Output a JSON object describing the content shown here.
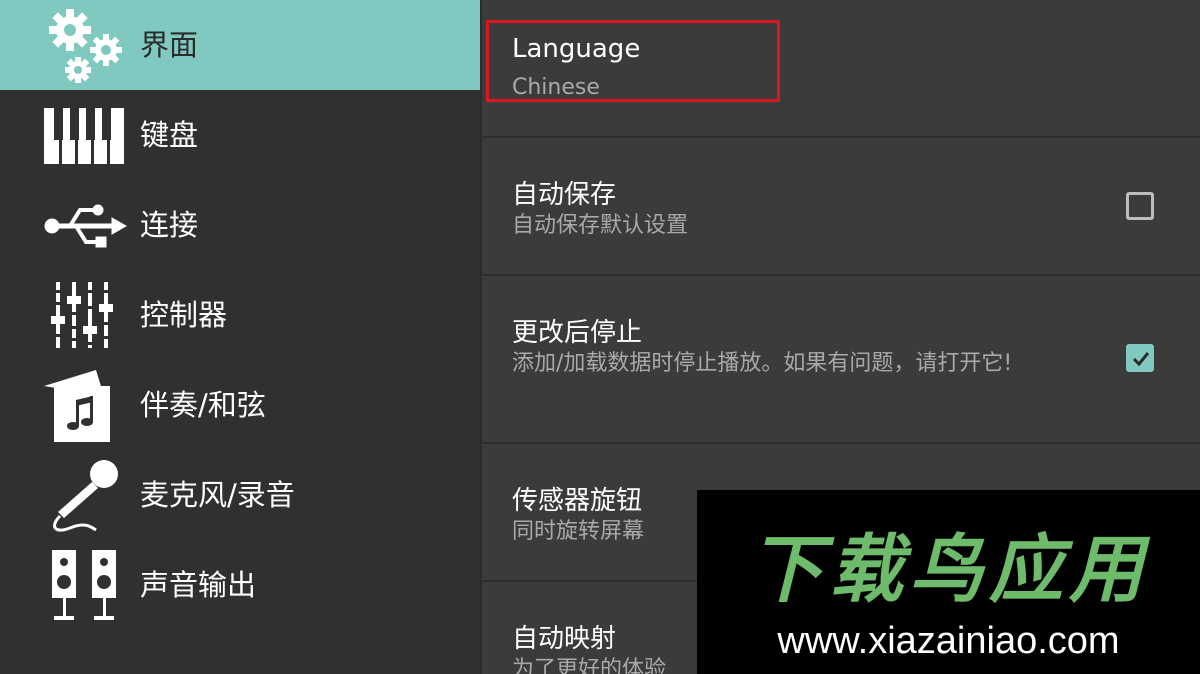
{
  "sidebar": {
    "items": [
      {
        "label": "界面",
        "icon": "gears-icon",
        "active": true
      },
      {
        "label": "键盘",
        "icon": "piano-keys-icon",
        "active": false
      },
      {
        "label": "连接",
        "icon": "usb-icon",
        "active": false
      },
      {
        "label": "控制器",
        "icon": "sliders-icon",
        "active": false
      },
      {
        "label": "伴奏/和弦",
        "icon": "music-note-icon",
        "active": false
      },
      {
        "label": "麦克风/录音",
        "icon": "microphone-icon",
        "active": false
      },
      {
        "label": "声音输出",
        "icon": "speakers-icon",
        "active": false
      }
    ]
  },
  "settings": [
    {
      "title": "Language",
      "subtitle": "Chinese",
      "checkbox": null,
      "highlighted": true
    },
    {
      "title": "自动保存",
      "subtitle": "自动保存默认设置",
      "checkbox": false
    },
    {
      "title": "更改后停止",
      "subtitle": "添加/加载数据时停止播放。如果有问题，请打开它!",
      "checkbox": true
    },
    {
      "title": "传感器旋钮",
      "subtitle": "同时旋转屏幕",
      "checkbox": null
    },
    {
      "title": "自动映射",
      "subtitle": "为了更好的体验",
      "checkbox": null
    }
  ],
  "watermark": {
    "title": "下载鸟应用",
    "url": "www.xiazainiao.com"
  },
  "colors": {
    "accent": "#7fc9c1",
    "highlight_border": "#d8191f",
    "sidebar_bg": "#303030",
    "main_bg": "#3b3b3b"
  }
}
